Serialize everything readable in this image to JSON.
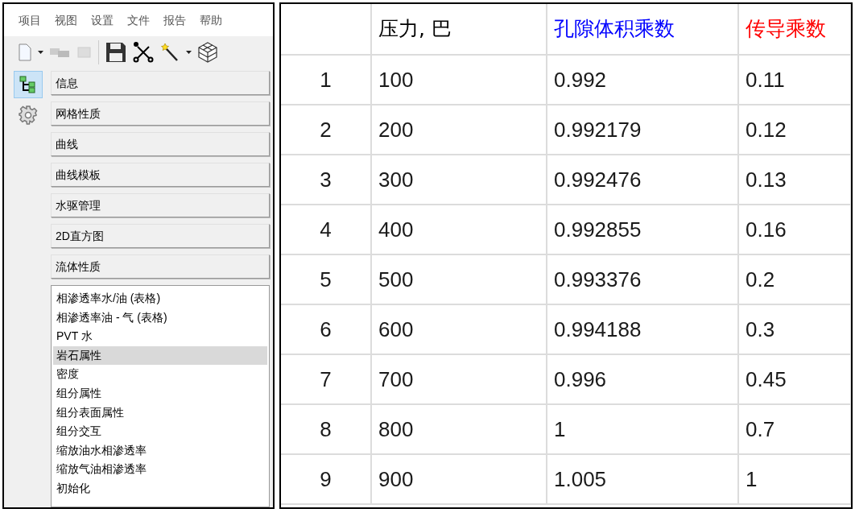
{
  "menu": [
    "项目",
    "视图",
    "设置",
    "文件",
    "报告",
    "帮助"
  ],
  "side_tabs": [
    {
      "kind": "tree",
      "selected": true
    },
    {
      "kind": "gear",
      "selected": false
    }
  ],
  "sections": [
    "信息",
    "网格性质",
    "曲线",
    "曲线模板",
    "水驱管理",
    "2D直方图",
    "流体性质"
  ],
  "list": [
    {
      "label": "相渗透率水/油 (表格)",
      "selected": false
    },
    {
      "label": "相渗透率油 - 气 (表格)",
      "selected": false
    },
    {
      "label": "PVT 水",
      "selected": false
    },
    {
      "label": "岩石属性",
      "selected": true
    },
    {
      "label": "密度",
      "selected": false
    },
    {
      "label": "组分属性",
      "selected": false
    },
    {
      "label": "组分表面属性",
      "selected": false
    },
    {
      "label": "组分交互",
      "selected": false
    },
    {
      "label": "缩放油水相渗透率",
      "selected": false
    },
    {
      "label": "缩放气油相渗透率",
      "selected": false
    },
    {
      "label": "初始化",
      "selected": false
    }
  ],
  "table": {
    "columns": [
      {},
      {
        "label": "压力, 巴",
        "color": "#000000"
      },
      {
        "label": "孔隙体积乘数",
        "color": "#0000ff"
      },
      {
        "label": "传导乘数",
        "color": "#ff0000"
      }
    ],
    "rows": [
      [
        "1",
        "100",
        "0.992",
        "0.11"
      ],
      [
        "2",
        "200",
        "0.992179",
        "0.12"
      ],
      [
        "3",
        "300",
        "0.992476",
        "0.13"
      ],
      [
        "4",
        "400",
        "0.992855",
        "0.16"
      ],
      [
        "5",
        "500",
        "0.993376",
        "0.2"
      ],
      [
        "6",
        "600",
        "0.994188",
        "0.3"
      ],
      [
        "7",
        "700",
        "0.996",
        "0.45"
      ],
      [
        "8",
        "800",
        "1",
        "0.7"
      ],
      [
        "9",
        "900",
        "1.005",
        "1"
      ]
    ]
  }
}
